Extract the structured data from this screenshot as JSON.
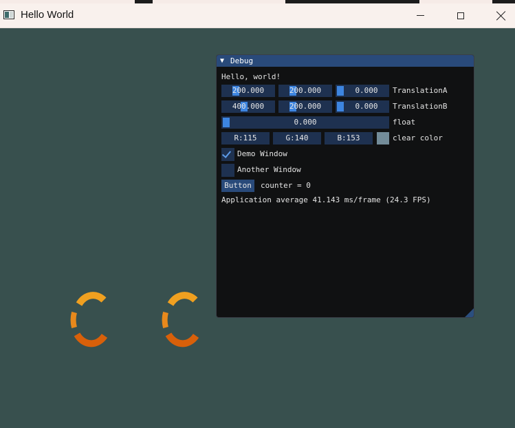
{
  "window": {
    "title": "Hello World"
  },
  "imgui": {
    "title": "Debug",
    "hello_text": "Hello, world!",
    "translation_a": {
      "x": "200.000",
      "y": "200.000",
      "z": "0.000",
      "label": "TranslationA"
    },
    "translation_b": {
      "x": "400.000",
      "y": "200.000",
      "z": "0.000",
      "label": "TranslationB"
    },
    "float_slider": {
      "value": "0.000",
      "label": "float"
    },
    "clear_color": {
      "r": "R:115",
      "g": "G:140",
      "b": "B:153",
      "label": "clear color",
      "swatch": "#738c99"
    },
    "demo_window": {
      "label": "Demo Window",
      "checked": true
    },
    "another_window": {
      "label": "Another Window",
      "checked": false
    },
    "button": {
      "label": "Button",
      "counter_text": "counter = 0"
    },
    "fps_text": "Application average 41.143 ms/frame (24.3 FPS)"
  },
  "colors": {
    "background": "#38504e",
    "spinner_light": "#f0a020",
    "spinner_dark": "#d8600a"
  },
  "icons": [
    "app-icon",
    "minimize-icon",
    "maximize-icon",
    "close-icon",
    "collapse-arrow-icon",
    "check-icon",
    "resize-grip-icon"
  ]
}
